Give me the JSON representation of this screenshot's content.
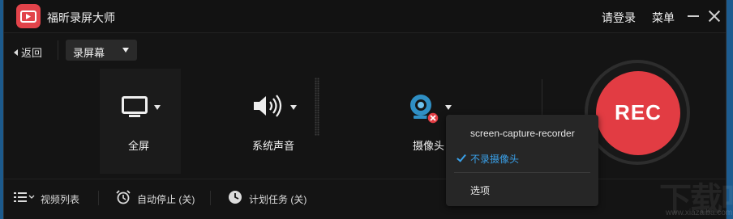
{
  "app": {
    "title": "福昕录屏大师",
    "login_label": "请登录",
    "menu_label": "菜单",
    "brand_color": "#e2434a"
  },
  "toolbar": {
    "back_label": "返回",
    "mode_selected": "录屏幕"
  },
  "sources": {
    "screen": {
      "label": "全屏",
      "icon": "monitor-icon"
    },
    "audio": {
      "label": "系统声音",
      "icon": "speaker-icon"
    },
    "camera": {
      "label": "摄像头",
      "icon": "webcam-icon",
      "status_icon": "disabled-x-icon"
    }
  },
  "record": {
    "label": "REC",
    "color": "#e23c43"
  },
  "camera_dropdown": {
    "items": [
      {
        "label": "screen-capture-recorder",
        "selected": false
      },
      {
        "label": "不录摄像头",
        "selected": true
      },
      {
        "label": "选项",
        "selected": false
      }
    ],
    "selected_color": "#3aa0e8"
  },
  "bottom_bar": {
    "video_list_label": "视频列表",
    "auto_stop_label": "自动停止 (关)",
    "schedule_label": "计划任务 (关)"
  },
  "watermark": {
    "text": "下载吧",
    "url": "www.xiazaiba.com"
  }
}
